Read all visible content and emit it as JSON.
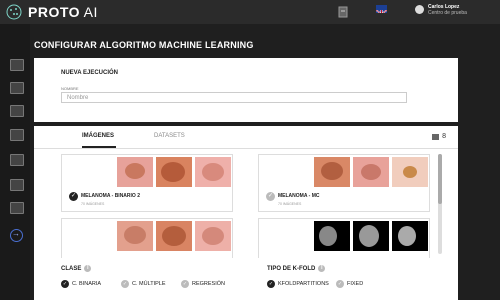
{
  "app": {
    "logo_main": "PROTO",
    "logo_accent": "AI",
    "user_name": "Carlos Lopez",
    "user_org": "Centro de prueba",
    "language_flag": "uk-flag-icon"
  },
  "page": {
    "title": "CONFIGURAR ALGORITMO MACHINE LEARNING"
  },
  "run": {
    "heading": "NUEVA EJECUCIÓN",
    "name_label": "NOMBRE",
    "name_placeholder": "Nombre"
  },
  "tabs": {
    "images": "IMÁGENES",
    "datasets": "DATASETS",
    "count": "8"
  },
  "datasets": [
    {
      "name": "MELANOMA - BINARIO 2",
      "sub": "70 IMÁGENES",
      "selected": true
    },
    {
      "name": "MELANOMA - MC",
      "sub": "70 IMÁGENES",
      "selected": false
    }
  ],
  "class_section": {
    "label": "CLASE",
    "options": [
      {
        "label": "C. BINARIA",
        "selected": true
      },
      {
        "label": "C. MÚLTIPLE",
        "selected": false
      },
      {
        "label": "REGRESIÓN",
        "selected": false
      }
    ]
  },
  "kfold_section": {
    "label": "TIPO DE K-FOLD",
    "options": [
      {
        "label": "KFOLDPARTITIONS",
        "selected": true
      },
      {
        "label": "FIXED",
        "selected": false
      }
    ]
  },
  "colors": {
    "accent_dark": "#222222",
    "sidebar_bg": "#1a1a1a",
    "topbar_bg": "#2b2b2b",
    "arrow_accent": "#4a6fd1"
  }
}
